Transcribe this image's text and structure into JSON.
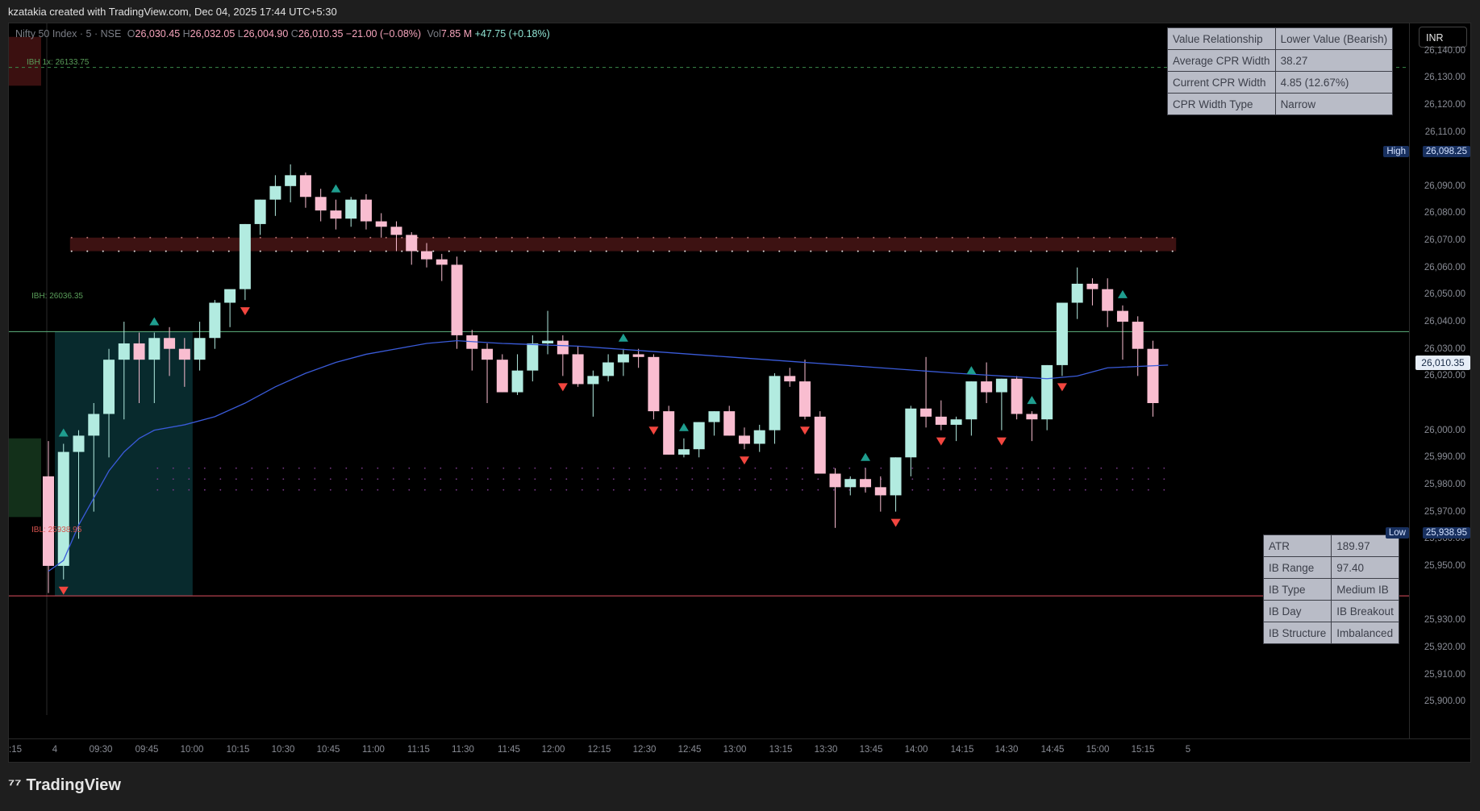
{
  "header": {
    "credit": "kzatakia created with TradingView.com, Dec 04, 2025 17:44 UTC+5:30"
  },
  "legend": {
    "symbol": "Nifty 50 Index · 5 · NSE",
    "o_label": "O",
    "open": "26,030.45",
    "h_label": "H",
    "high": "26,032.05",
    "l_label": "L",
    "low": "26,004.90",
    "c_label": "C",
    "close": "26,010.35",
    "change": "−21.00 (−0.08%)",
    "vol_label": "Vol",
    "volume": "7.85 M",
    "vol_change": "+47.75 (+0.18%)"
  },
  "cpr_table": [
    [
      "Value Relationship",
      "Lower Value (Bearish)"
    ],
    [
      "Average CPR Width",
      "38.27"
    ],
    [
      "Current CPR Width",
      "4.85 (12.67%)"
    ],
    [
      "CPR Width Type",
      "Narrow"
    ]
  ],
  "ib_table": [
    [
      "ATR",
      "189.97"
    ],
    [
      "IB Range",
      "97.40"
    ],
    [
      "IB Type",
      "Medium IB"
    ],
    [
      "IB Day",
      "IB Breakout"
    ],
    [
      "IB Structure",
      "Imbalanced"
    ]
  ],
  "levels": {
    "ibh1x": "IBH 1x: 26133.75",
    "ibh": "IBH: 26036.35",
    "ibl": "IBL: 25938.95"
  },
  "price_axis": {
    "currency": "INR",
    "ticks": [
      "26,140.00",
      "26,130.00",
      "26,120.00",
      "26,110.00",
      "26,090.00",
      "26,080.00",
      "26,070.00",
      "26,060.00",
      "26,050.00",
      "26,040.00",
      "26,030.00",
      "26,020.00",
      "26,000.00",
      "25,990.00",
      "25,980.00",
      "25,970.00",
      "25,960.00",
      "25,950.00",
      "25,930.00",
      "25,920.00",
      "25,910.00",
      "25,900.00"
    ],
    "high_tag": {
      "label": "High",
      "value": "26,098.25"
    },
    "low_tag": {
      "label": "Low",
      "value": "25,938.95"
    },
    "current_price": "26,010.35"
  },
  "time_axis": {
    "ticks": [
      ":15",
      "4",
      "09:30",
      "09:45",
      "10:00",
      "10:15",
      "10:30",
      "10:45",
      "11:00",
      "11:15",
      "11:30",
      "11:45",
      "12:00",
      "12:15",
      "12:30",
      "12:45",
      "13:00",
      "13:15",
      "13:30",
      "13:45",
      "14:00",
      "14:15",
      "14:30",
      "14:45",
      "15:00",
      "15:15",
      "5"
    ]
  },
  "colors": {
    "up": "#b2ebe0",
    "down": "#f9bdd0",
    "vwap": "#3a5bd9",
    "ibh": "#5fb580",
    "ibl": "#e0525f",
    "signal_up": "#1f9e8f",
    "signal_down": "#f2463f"
  },
  "footer": {
    "brand": "TradingView"
  },
  "chart_data": {
    "type": "candlestick",
    "title": "Nifty 50 Index · 5 · NSE",
    "ylim": [
      25895,
      26147
    ],
    "x": [
      "09:15",
      "09:20",
      "09:25",
      "09:30",
      "09:35",
      "09:40",
      "09:45",
      "09:50",
      "09:55",
      "10:00",
      "10:05",
      "10:10",
      "10:15",
      "10:20",
      "10:25",
      "10:30",
      "10:35",
      "10:40",
      "10:45",
      "10:50",
      "10:55",
      "11:00",
      "11:05",
      "11:10",
      "11:15",
      "11:20",
      "11:25",
      "11:30",
      "11:35",
      "11:40",
      "11:45",
      "11:50",
      "11:55",
      "12:00",
      "12:05",
      "12:10",
      "12:15",
      "12:20",
      "12:25",
      "12:30",
      "12:35",
      "12:40",
      "12:45",
      "12:50",
      "12:55",
      "13:00",
      "13:05",
      "13:10",
      "13:15",
      "13:20",
      "13:25",
      "13:30",
      "13:35",
      "13:40",
      "13:45",
      "13:50",
      "13:55",
      "14:00",
      "14:05",
      "14:10",
      "14:15",
      "14:20",
      "14:25",
      "14:30",
      "14:35",
      "14:40",
      "14:45",
      "14:50",
      "14:55",
      "15:00",
      "15:05",
      "15:10",
      "15:15",
      "15:20",
      "15:25"
    ],
    "ohlc": [
      [
        25983,
        25996,
        25940,
        25950
      ],
      [
        25950,
        25995,
        25945,
        25992
      ],
      [
        25992,
        26000,
        25960,
        25998
      ],
      [
        25998,
        26010,
        25970,
        26006
      ],
      [
        26006,
        26030,
        25990,
        26026
      ],
      [
        26026,
        26040,
        26004,
        26032
      ],
      [
        26032,
        26036,
        26010,
        26026
      ],
      [
        26026,
        26036,
        26010,
        26034
      ],
      [
        26034,
        26038,
        26020,
        26030
      ],
      [
        26030,
        26034,
        26016,
        26026
      ],
      [
        26026,
        26040,
        26022,
        26034
      ],
      [
        26034,
        26048,
        26030,
        26047
      ],
      [
        26047,
        26051,
        26038,
        26052
      ],
      [
        26052,
        26076,
        26048,
        26076
      ],
      [
        26076,
        26085,
        26072,
        26085
      ],
      [
        26085,
        26094,
        26079,
        26090
      ],
      [
        26090,
        26098,
        26084,
        26094
      ],
      [
        26094,
        26095,
        26082,
        26086
      ],
      [
        26086,
        26089,
        26077,
        26081
      ],
      [
        26081,
        26085,
        26074,
        26078
      ],
      [
        26078,
        26086,
        26075,
        26085
      ],
      [
        26085,
        26087,
        26074,
        26077
      ],
      [
        26077,
        26080,
        26071,
        26075
      ],
      [
        26075,
        26077,
        26066,
        26072
      ],
      [
        26072,
        26073,
        26061,
        26066
      ],
      [
        26066,
        26069,
        26060,
        26063
      ],
      [
        26063,
        26065,
        26055,
        26061
      ],
      [
        26061,
        26064,
        26030,
        26035
      ],
      [
        26035,
        26037,
        26022,
        26030
      ],
      [
        26030,
        26032,
        26010,
        26026
      ],
      [
        26026,
        26028,
        26014,
        26014
      ],
      [
        26014,
        26028,
        26013,
        26022
      ],
      [
        26022,
        26035,
        26018,
        26032
      ],
      [
        26032,
        26044,
        26028,
        26033
      ],
      [
        26033,
        26035,
        26020,
        26028
      ],
      [
        26028,
        26031,
        26016,
        26017
      ],
      [
        26017,
        26022,
        26005,
        26020
      ],
      [
        26020,
        26028,
        26018,
        26025
      ],
      [
        26025,
        26030,
        26020,
        26028
      ],
      [
        26028,
        26030,
        26023,
        26027
      ],
      [
        26027,
        26028,
        26004,
        26007
      ],
      [
        26007,
        26009,
        25991,
        25991
      ],
      [
        25991,
        25997,
        25990,
        25993
      ],
      [
        25993,
        26003,
        25990,
        26003
      ],
      [
        26003,
        26007,
        25998,
        26007
      ],
      [
        26007,
        26009,
        25998,
        25998
      ],
      [
        25998,
        26001,
        25993,
        25995
      ],
      [
        25995,
        26002,
        25992,
        26000
      ],
      [
        26000,
        26021,
        25995,
        26020
      ],
      [
        26020,
        26023,
        26016,
        26018
      ],
      [
        26018,
        26026,
        26004,
        26005
      ],
      [
        26005,
        26007,
        25984,
        25984
      ],
      [
        25984,
        25986,
        25964,
        25979
      ],
      [
        25979,
        25983,
        25976,
        25982
      ],
      [
        25982,
        25986,
        25977,
        25979
      ],
      [
        25979,
        25983,
        25970,
        25976
      ],
      [
        25976,
        25990,
        25970,
        25990
      ],
      [
        25990,
        26009,
        25983,
        26008
      ],
      [
        26008,
        26027,
        26001,
        26005
      ],
      [
        26005,
        26011,
        26000,
        26002
      ],
      [
        26002,
        26005,
        25996,
        26004
      ],
      [
        26004,
        26018,
        25998,
        26018
      ],
      [
        26018,
        26025,
        26010,
        26014
      ],
      [
        26014,
        26019,
        26000,
        26019
      ],
      [
        26019,
        26020,
        26004,
        26006
      ],
      [
        26006,
        26007,
        25996,
        26004
      ],
      [
        26004,
        26024,
        26000,
        26024
      ],
      [
        26024,
        26047,
        26020,
        26047
      ],
      [
        26047,
        26060,
        26041,
        26054
      ],
      [
        26054,
        26056,
        26046,
        26052
      ],
      [
        26052,
        26056,
        26038,
        26044
      ],
      [
        26044,
        26046,
        26026,
        26040
      ],
      [
        26040,
        26042,
        26020,
        26030
      ],
      [
        26030,
        26033,
        26005,
        26010
      ]
    ],
    "vwap": [
      [
        0,
        25948
      ],
      [
        1,
        25952
      ],
      [
        2,
        25965
      ],
      [
        3,
        25975
      ],
      [
        4,
        25985
      ],
      [
        5,
        25992
      ],
      [
        6,
        25997
      ],
      [
        7,
        26000
      ],
      [
        9,
        26002
      ],
      [
        11,
        26005
      ],
      [
        13,
        26010
      ],
      [
        15,
        26016
      ],
      [
        17,
        26021
      ],
      [
        19,
        26025
      ],
      [
        21,
        26028
      ],
      [
        23,
        26030
      ],
      [
        25,
        26032
      ],
      [
        27,
        26033
      ],
      [
        30,
        26032
      ],
      [
        35,
        26031
      ],
      [
        40,
        26029
      ],
      [
        45,
        26027
      ],
      [
        50,
        26025
      ],
      [
        55,
        26023
      ],
      [
        60,
        26021
      ],
      [
        66,
        26019
      ],
      [
        68,
        26020
      ],
      [
        70,
        26023
      ],
      [
        74,
        26024
      ]
    ],
    "signals_up": [
      1,
      7,
      19,
      38,
      42,
      54,
      61,
      65,
      71
    ],
    "signals_down": [
      1,
      13,
      34,
      40,
      46,
      50,
      56,
      59,
      63,
      67
    ],
    "levels": {
      "ibh": 26036.35,
      "ibl": 25938.95,
      "ibh1x": 26133.75,
      "cpr_top": 26071,
      "cpr_bottom": 26066,
      "cpr2_top": 25986,
      "cpr2_bottom": 25978
    }
  }
}
